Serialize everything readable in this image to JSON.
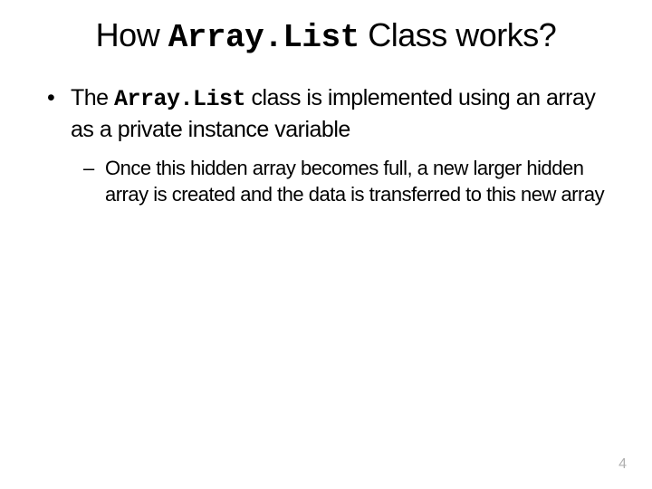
{
  "title": {
    "part1": "How ",
    "code": "Array.List",
    "part2": " Class works?"
  },
  "bullet1": {
    "part1": "The ",
    "code": "Array.List",
    "part2": " class is implemented using an array as a private instance variable"
  },
  "sub1": "Once this hidden array becomes full, a new larger hidden array is created and the data is transferred to this new array",
  "pageNumber": "4"
}
